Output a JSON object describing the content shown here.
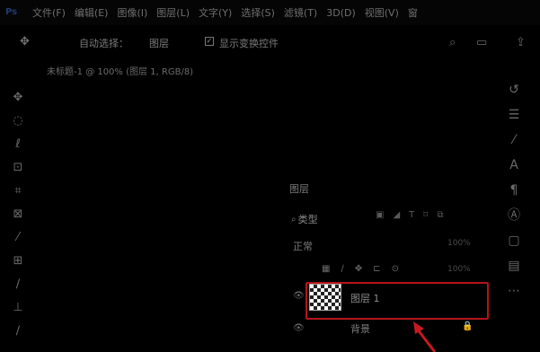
{
  "menu": {
    "logo": "Ps",
    "items": [
      "文件(F)",
      "编辑(E)",
      "图像(I)",
      "图层(L)",
      "文字(Y)",
      "选择(S)",
      "滤镜(T)",
      "3D(D)",
      "视图(V)",
      "窗"
    ]
  },
  "options": {
    "auto_select": "自动选择：",
    "layer_dropdown": "图层",
    "show_transform": "显示变换控件"
  },
  "document": {
    "tab": "未标题-1 @ 100% (图层 1, RGB/8)"
  },
  "layers_panel": {
    "title": "图层",
    "filter_label": "类型",
    "blend_mode": "正常",
    "opacity": "100%",
    "fill": "100%",
    "layers": [
      {
        "name": "图层 1",
        "selected": true
      },
      {
        "name": "背景",
        "locked": true
      }
    ]
  },
  "colors": {
    "highlight": "#b3151a",
    "background": "#000000"
  }
}
